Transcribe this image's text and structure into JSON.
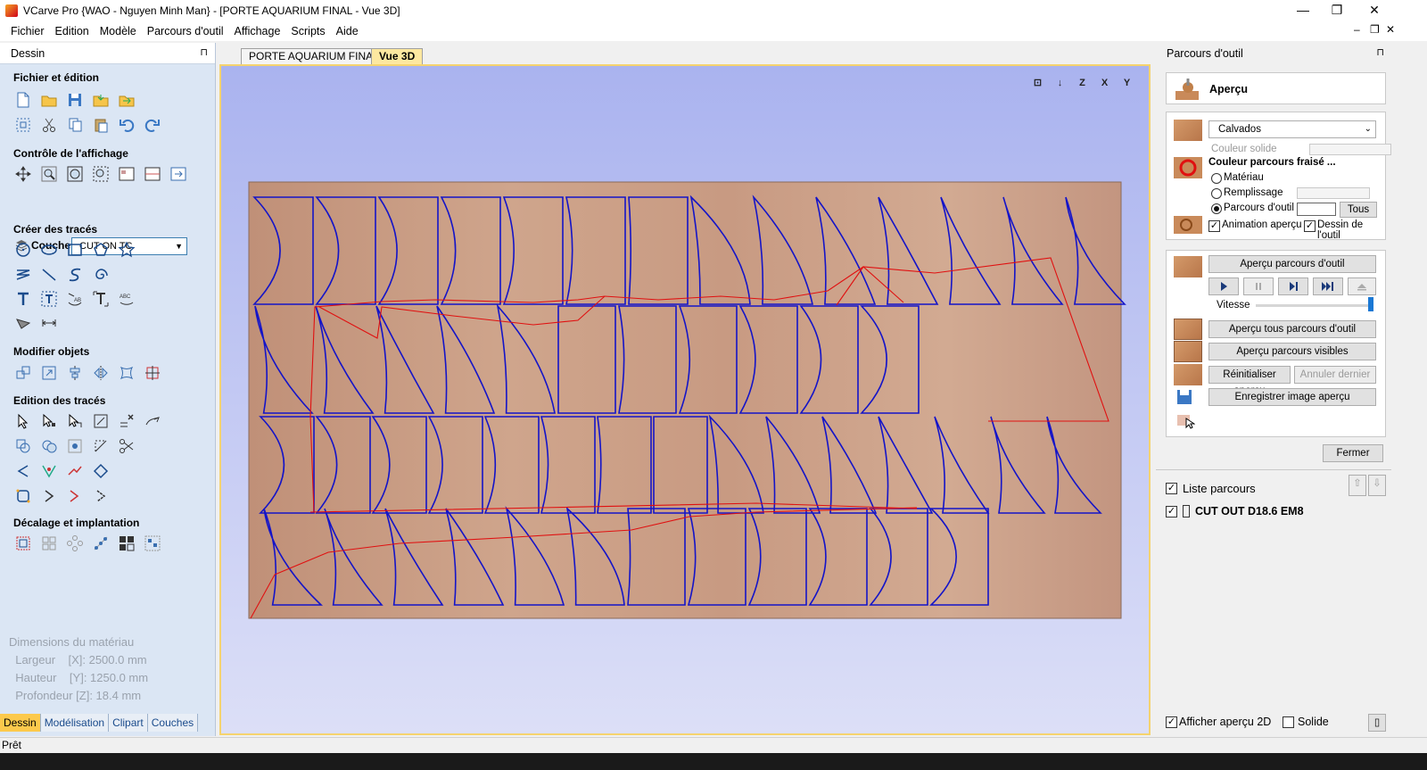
{
  "window": {
    "title": "VCarve Pro {WAO - Nguyen Minh Man} - [PORTE AQUARIUM FINAL - Vue 3D]",
    "minimize": "—",
    "maximize": "❐",
    "close": "✕"
  },
  "menu": {
    "items": [
      "Fichier",
      "Edition",
      "Modèle",
      "Parcours d'outil",
      "Affichage",
      "Scripts",
      "Aide"
    ],
    "mdi_min": "–",
    "mdi_restore": "❐",
    "mdi_close": "✕"
  },
  "left_panel": {
    "title": "Dessin",
    "pin": "⊓",
    "sections": {
      "file_edit": "Fichier et édition",
      "view_control": "Contrôle de l'affichage",
      "create_vectors": "Créer des tracés",
      "modify_objects": "Modifier objets",
      "edit_vectors": "Edition des tracés",
      "offset_layout": "Décalage et implantation"
    },
    "layer_label": "Couche",
    "layer_value": "CUT ON TC",
    "material_dims": {
      "title": "Dimensions du matériau",
      "width": "  Largeur    [X]: 2500.0 mm",
      "height": "  Hauteur    [Y]: 1250.0 mm",
      "depth": "  Profondeur [Z]: 18.4 mm"
    },
    "tabs": [
      "Dessin",
      "Modélisation",
      "Clipart",
      "Couches"
    ]
  },
  "doc_tabs": [
    "PORTE AQUARIUM FINAL",
    "Vue 3D"
  ],
  "view_tools": [
    "⊡",
    "↓",
    "Z",
    "X",
    "Y"
  ],
  "right_panel": {
    "title": "Parcours d'outil",
    "preview_title": "Aperçu",
    "material_select": "Calvados",
    "solid_color_label": "Couleur solide",
    "toolpath_color_title": "Couleur parcours fraisé ...",
    "radio_material": "Matériau",
    "radio_fill": "Remplissage",
    "radio_toolpath": "Parcours d'outil",
    "all_button": "Tous",
    "animate_preview": "Animation aperçu",
    "tool_drawing": "Dessin de l'outil",
    "preview_toolpath_btn": "Aperçu parcours d'outil",
    "speed_label": "Vitesse",
    "preview_all_btn": "Aperçu tous parcours d'outil",
    "preview_visible_btn": "Aperçu parcours visibles",
    "reset_preview_btn": "Réinitialiser aperçu",
    "undo_last_btn": "Annuler dernier",
    "save_preview_btn": "Enregistrer image aperçu",
    "close_btn": "Fermer",
    "toolpath_list_title": "Liste parcours",
    "toolpath_item": "CUT OUT D18.6 EM8",
    "show_2d_preview": "Afficher aperçu 2D",
    "solid": "Solide"
  },
  "status": "Prêt",
  "colors": {
    "accent_tab": "#fcc94c",
    "vector_blue": "#1414c8",
    "toolpath_red": "#e01010",
    "wood": "#c99a80"
  }
}
